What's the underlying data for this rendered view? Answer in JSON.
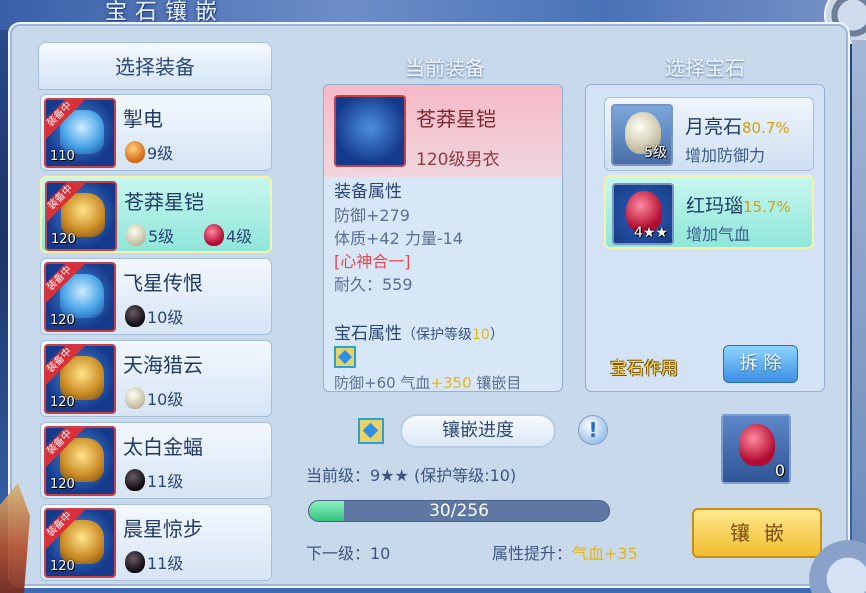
{
  "window": {
    "title": "宝石镶嵌"
  },
  "left": {
    "header": "选择装备",
    "items": [
      {
        "name": "掣电",
        "level": "110",
        "badge": "装备中",
        "gems": [
          {
            "kind": "amber",
            "label": "9级"
          }
        ]
      },
      {
        "name": "苍莽星铠",
        "level": "120",
        "badge": "装备中",
        "gems": [
          {
            "kind": "moon",
            "label": "5级"
          },
          {
            "kind": "ruby",
            "label": "4级"
          }
        ]
      },
      {
        "name": "飞星传恨",
        "level": "120",
        "badge": "装备中",
        "gems": [
          {
            "kind": "onyx",
            "label": "10级"
          }
        ]
      },
      {
        "name": "天海猎云",
        "level": "120",
        "badge": "装备中",
        "gems": [
          {
            "kind": "moon",
            "label": "10级"
          }
        ]
      },
      {
        "name": "太白金蝠",
        "level": "120",
        "badge": "装备中",
        "gems": [
          {
            "kind": "onyx",
            "label": "11级"
          }
        ]
      },
      {
        "name": "晨星惊步",
        "level": "120",
        "badge": "装备中",
        "gems": [
          {
            "kind": "onyx",
            "label": "11级"
          }
        ]
      }
    ]
  },
  "middle": {
    "title": "当前装备",
    "equip_name": "苍莽星铠",
    "equip_sub": "120级男衣",
    "attr_heading": "装备属性",
    "attrs": [
      "防御+279",
      "体质+42 力量-14"
    ],
    "special": "[心神合一]",
    "durability": "耐久：559",
    "gem_attr_heading": "宝石属性",
    "gem_attr_protect_prefix": "（保护等级",
    "gem_attr_protect_level": "10",
    "gem_attr_protect_suffix": "）",
    "clipped_prefix": "防御+60 气血",
    "clipped_yellow": "+350",
    "clipped_suffix": " 镶嵌目"
  },
  "progress": {
    "title": "镶嵌进度",
    "current_level": "当前级：9★★ (保护等级:10)",
    "value": 30,
    "max": 256,
    "text": "30/256",
    "next_level": "下一级：10",
    "attr_up_label": "属性提升：",
    "attr_up_value": "气血+35"
  },
  "right": {
    "title": "选择宝石",
    "gems": [
      {
        "name": "月亮石",
        "pct": "80.7%",
        "effect": "增加防御力",
        "count": "5级",
        "kind": "moon"
      },
      {
        "name": "红玛瑙",
        "pct": "15.7%",
        "effect": "增加气血",
        "count": "4★★",
        "kind": "ruby"
      }
    ],
    "func_label": "宝石作用",
    "remove_label": "拆 除"
  },
  "slot": {
    "count": "0"
  },
  "inlay_label": "镶嵌",
  "colors": {
    "accent_yellow": "#e5b515",
    "selected_bg": "#8fe6da",
    "panel_bg": "#c9d9ec"
  }
}
